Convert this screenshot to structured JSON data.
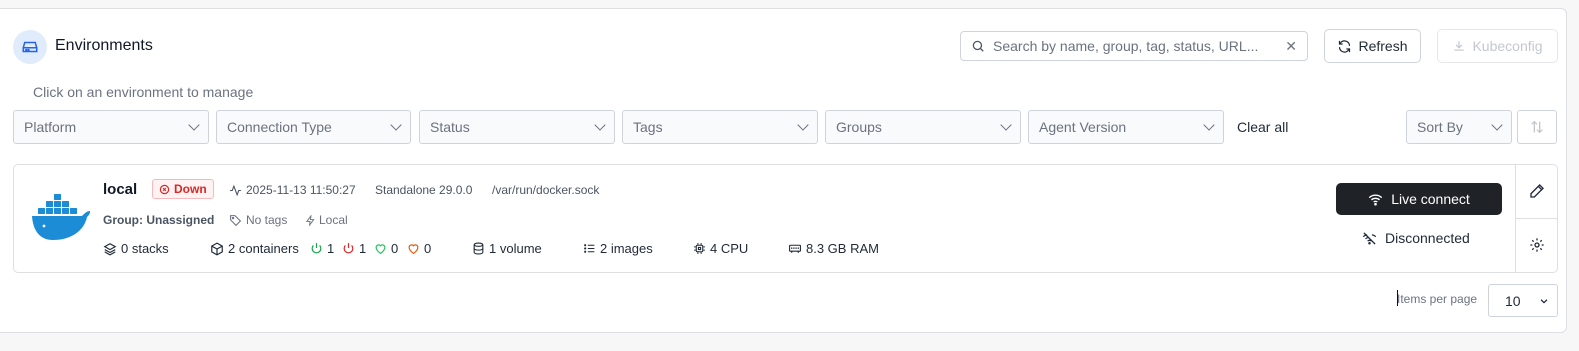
{
  "header": {
    "title": "Environments",
    "search_placeholder": "Search by name, group, tag, status, URL...",
    "refresh_label": "Refresh",
    "kubeconfig_label": "Kubeconfig"
  },
  "hint": "Click on an environment to manage",
  "filters": [
    {
      "label": "Platform"
    },
    {
      "label": "Connection Type"
    },
    {
      "label": "Status"
    },
    {
      "label": "Tags"
    },
    {
      "label": "Groups"
    },
    {
      "label": "Agent Version"
    }
  ],
  "clear_all": "Clear all",
  "sort_by": "Sort By",
  "environment": {
    "name": "local",
    "status": "Down",
    "heartbeat": "2025-11-13 11:50:27",
    "type_version": "Standalone 29.0.0",
    "url": "/var/run/docker.sock",
    "group": "Group: Unassigned",
    "tags": "No tags",
    "connection": "Local",
    "stacks": "0 stacks",
    "containers": "2 containers",
    "running": "1",
    "stopped": "1",
    "healthy": "0",
    "unhealthy": "0",
    "volumes": "1 volume",
    "images": "2 images",
    "cpu": "4 CPU",
    "ram": "8.3 GB RAM",
    "live_connect": "Live connect",
    "connection_state": "Disconnected"
  },
  "pagination": {
    "items_per_page_label": "Items per page",
    "items_per_page_value": "10"
  },
  "colors": {
    "docker_blue": "#1d8cd6",
    "down_red": "#dc2626",
    "running_green": "#16a34a",
    "healthy_green": "#22c55e",
    "unhealthy_orange": "#ea580c",
    "live_button": "#1f2328"
  }
}
